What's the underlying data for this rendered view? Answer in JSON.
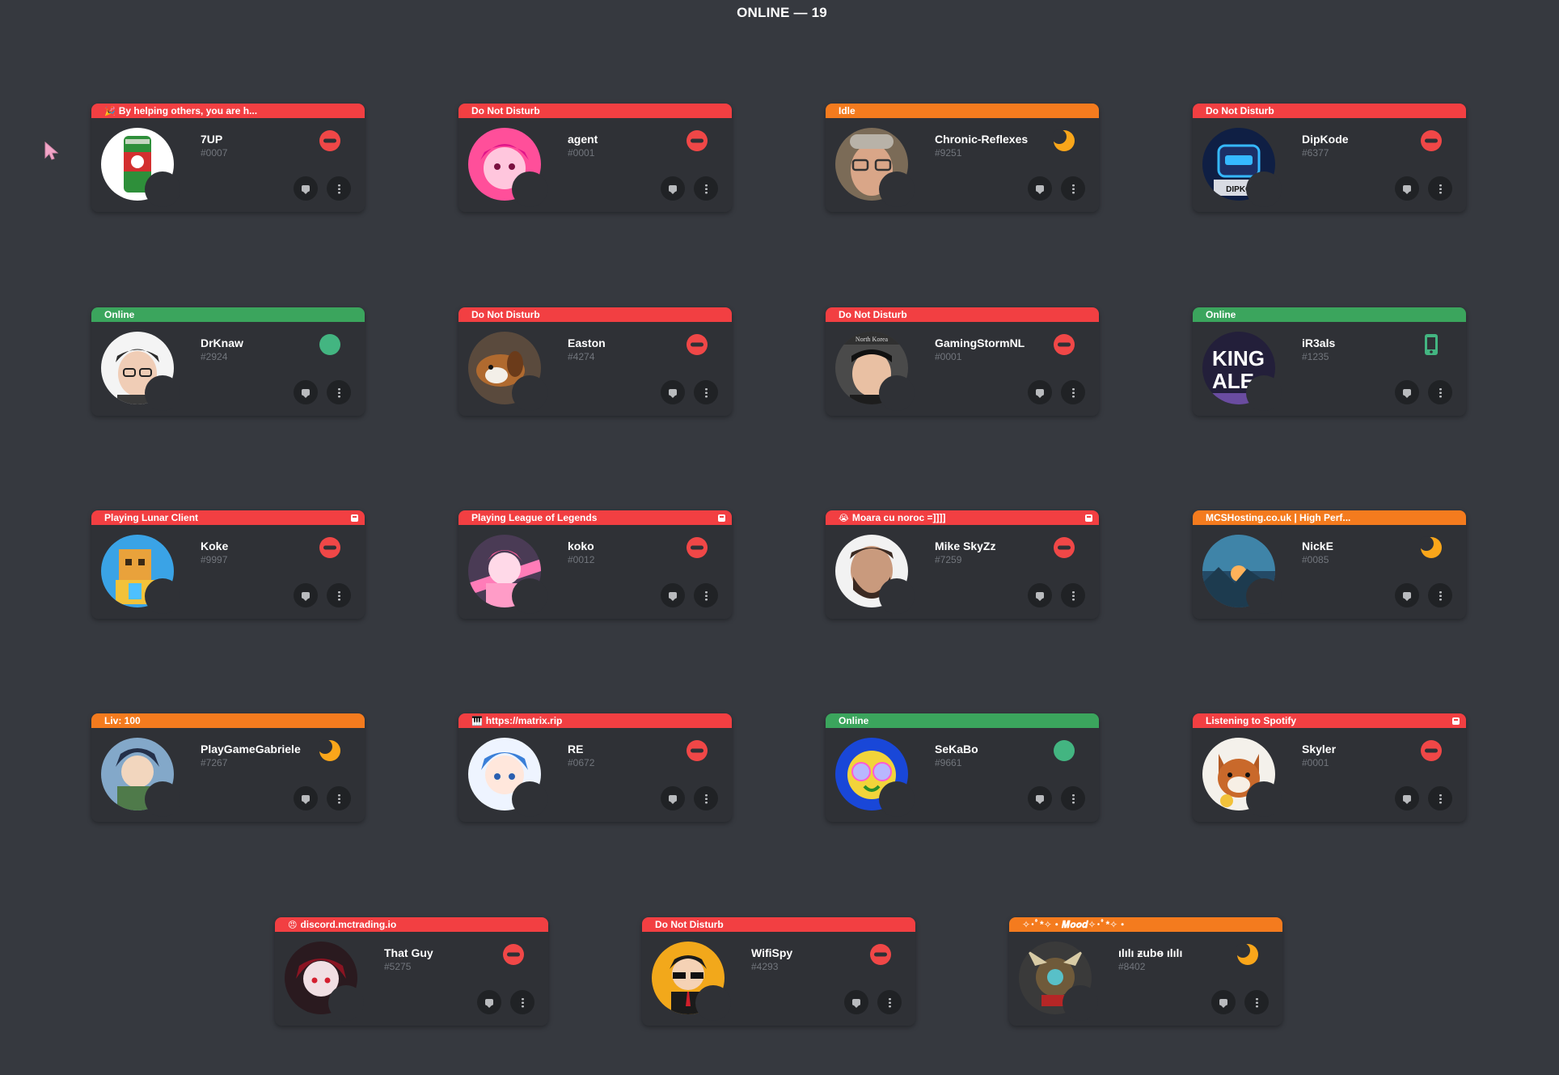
{
  "heading": "ONLINE — 19",
  "colors": {
    "background": "#36393f",
    "card": "#2f3136",
    "dnd": "#f04747",
    "idle": "#faa61a",
    "online": "#43b581",
    "banner_red": "#f23f42",
    "banner_orange": "#f47b1e",
    "banner_green": "#3ba55d"
  },
  "friends": [
    {
      "name": "7UP",
      "tag": "#0007",
      "banner": "By helping others, you are h...",
      "banner_color": "#f23f42",
      "banner_icon": "🎉",
      "status": "dnd",
      "avatar": "can",
      "badge": false
    },
    {
      "name": "agent",
      "tag": "#0001",
      "banner": "Do Not Disturb",
      "banner_color": "#f23f42",
      "status": "dnd",
      "avatar": "pink-anime",
      "badge": false
    },
    {
      "name": "Chronic-Reflexes",
      "tag": "#9251",
      "banner": "Idle",
      "banner_color": "#f47b1e",
      "status": "idle",
      "avatar": "man-glasses",
      "badge": false
    },
    {
      "name": "DipKode",
      "tag": "#6377",
      "banner": "Do Not Disturb",
      "banner_color": "#f23f42",
      "status": "dnd",
      "avatar": "robot",
      "badge": false
    },
    {
      "name": "DrKnaw",
      "tag": "#2924",
      "banner": "Online",
      "banner_color": "#3ba55d",
      "status": "online",
      "avatar": "boy",
      "badge": false
    },
    {
      "name": "Easton",
      "tag": "#4274",
      "banner": "Do Not Disturb",
      "banner_color": "#f23f42",
      "status": "dnd",
      "avatar": "dog",
      "badge": false
    },
    {
      "name": "GamingStormNL",
      "tag": "#0001",
      "banner": "Do Not Disturb",
      "banner_color": "#f23f42",
      "status": "dnd",
      "avatar": "leader",
      "badge": false
    },
    {
      "name": "iR3als",
      "tag": "#1235",
      "banner": "Online",
      "banner_color": "#3ba55d",
      "status": "mobile",
      "avatar": "kingale",
      "badge": false
    },
    {
      "name": "Koke",
      "tag": "#9997",
      "banner": "Playing Lunar Client",
      "banner_color": "#f23f42",
      "status": "dnd",
      "avatar": "minecraft",
      "badge": true
    },
    {
      "name": "koko",
      "tag": "#0012",
      "banner": "Playing League of Legends",
      "banner_color": "#f23f42",
      "status": "dnd",
      "avatar": "pink-girl",
      "badge": true
    },
    {
      "name": "Mike SkyZz",
      "tag": "#7259",
      "banner": "Moara cu noroc =]]]]",
      "banner_color": "#f23f42",
      "banner_icon": "😭",
      "status": "dnd",
      "avatar": "bearded",
      "badge": true
    },
    {
      "name": "NickE",
      "tag": "#0085",
      "banner": "MCSHosting.co.uk | High Perf...",
      "banner_color": "#f47b1e",
      "status": "idle",
      "avatar": "landscape",
      "badge": false
    },
    {
      "name": "PlayGameGabriele",
      "tag": "#7267",
      "banner": "Liv: 100",
      "banner_color": "#f47b1e",
      "status": "idle",
      "avatar": "anime-boy",
      "badge": false
    },
    {
      "name": "RE",
      "tag": "#0672",
      "banner": "https://matrix.rip",
      "banner_color": "#f23f42",
      "banner_icon": "🎹",
      "status": "dnd",
      "avatar": "blue-anime",
      "badge": false
    },
    {
      "name": "SeKaBo",
      "tag": "#9661",
      "banner": "Online",
      "banner_color": "#3ba55d",
      "status": "online",
      "avatar": "psychedelic",
      "badge": false
    },
    {
      "name": "Skyler",
      "tag": "#0001",
      "banner": "Listening to Spotify",
      "banner_color": "#f23f42",
      "status": "dnd",
      "avatar": "shiba",
      "badge": true
    },
    {
      "name": "That Guy",
      "tag": "#5275",
      "banner": "discord.mctrading.io",
      "banner_color": "#f23f42",
      "banner_icon": "😠",
      "status": "dnd",
      "avatar": "red-anime",
      "badge": false
    },
    {
      "name": "WifiSpy",
      "tag": "#4293",
      "banner": "Do Not Disturb",
      "banner_color": "#f23f42",
      "status": "dnd",
      "avatar": "sunglasses",
      "badge": false
    },
    {
      "name": "ılılı ƶubɵ ılılı",
      "tag": "#8402",
      "banner": "✧･ﾟ*✧・𝑴𝒐𝒐𝒅✧･ﾟ*✧・",
      "banner_color": "#f47b1e",
      "status": "idle",
      "avatar": "samurai",
      "badge": false
    }
  ]
}
